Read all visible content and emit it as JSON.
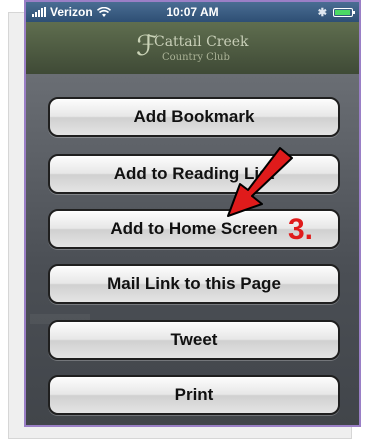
{
  "status_bar": {
    "carrier": "Verizon",
    "time": "10:07 AM"
  },
  "header": {
    "logo_line1": "Cattail Creek",
    "logo_line2": "Country Club"
  },
  "action_sheet": {
    "buttons": [
      {
        "label": "Add Bookmark"
      },
      {
        "label": "Add to Reading List"
      },
      {
        "label": "Add to Home Screen"
      },
      {
        "label": "Mail Link to this Page"
      },
      {
        "label": "Tweet"
      },
      {
        "label": "Print"
      }
    ]
  },
  "annotation": {
    "step": "3.",
    "color": "#e01b1b"
  },
  "icons": [
    "wifi-icon",
    "bluetooth-icon",
    "battery-icon",
    "signal-icon",
    "annotation-arrow-icon"
  ]
}
